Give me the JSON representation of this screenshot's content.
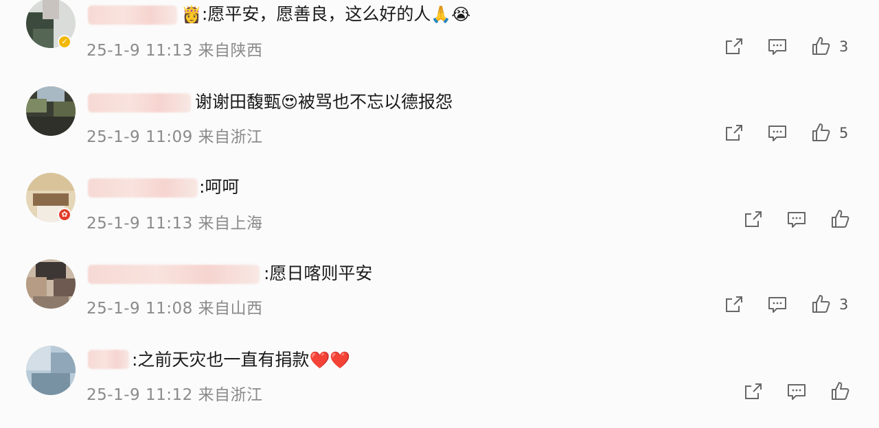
{
  "comments": [
    {
      "text": ":愿平安，愿善良，这么好的人",
      "emoji_lead": "👸",
      "emoji_tail": "🙏😭",
      "time": "25-1-9 11:13",
      "location": "来自陕西",
      "likes": "3",
      "avatar_badge": "verified-gold"
    },
    {
      "text": "谢谢田馥甄",
      "emoji_mid": "😍",
      "text_tail": "被骂也不忘以德报怨",
      "time": "25-1-9 11:09",
      "location": "来自浙江",
      "likes": "5"
    },
    {
      "text": ":呵呵",
      "time": "25-1-9 11:13",
      "location": "来自上海",
      "likes": "",
      "avatar_badge": "red"
    },
    {
      "text": ":愿日喀则平安",
      "time": "25-1-9 11:08",
      "location": "来自山西",
      "likes": "3"
    },
    {
      "text": ":之前天灾也一直有捐款",
      "emoji_tail": "❤️❤️",
      "time": "25-1-9 11:12",
      "location": "来自浙江",
      "likes": ""
    }
  ],
  "icons": {
    "share": "share-icon",
    "comment": "comment-icon",
    "like": "thumbs-up-icon"
  }
}
